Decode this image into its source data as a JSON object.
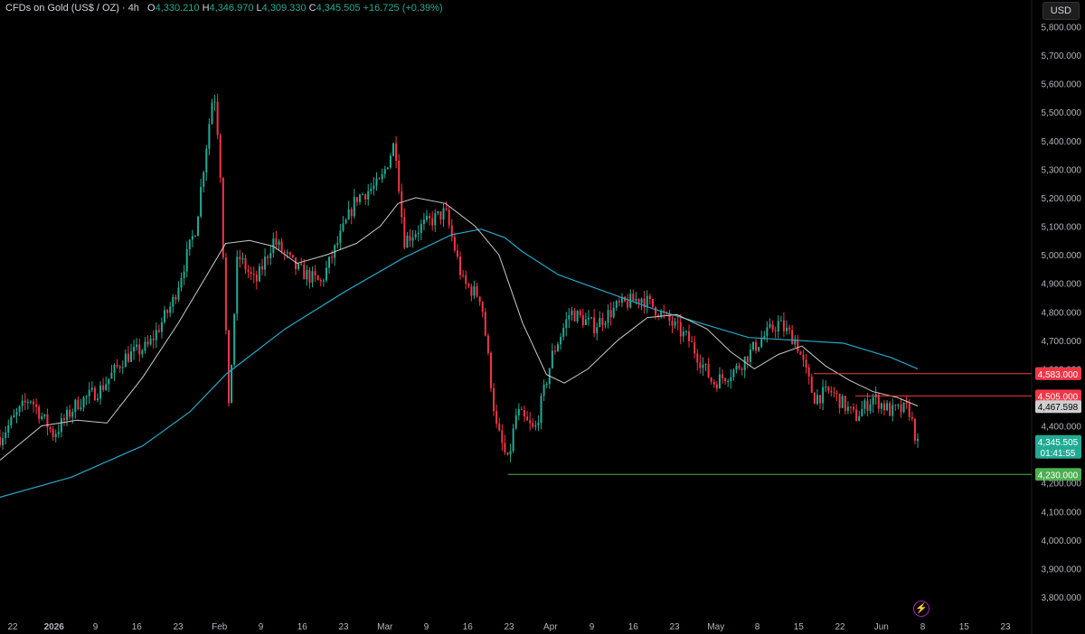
{
  "header": {
    "symbol": "CFDs on Gold (US$ / OZ) · 4h",
    "open_label": "O",
    "open": "4,330.210",
    "high_label": "H",
    "high": "4,346.970",
    "low_label": "L",
    "low": "4,309.330",
    "close_label": "C",
    "close": "4,345.505",
    "change": "+16.725 (+0.39%)"
  },
  "currency": "USD",
  "colors": {
    "up": "#22ab94",
    "down": "#f23645",
    "ma_fast": "#c9c9c9",
    "ma_slow": "#26a7c6",
    "support": "#4caf50",
    "background": "#000000",
    "axis_text": "#b2b5be"
  },
  "chart_data": {
    "type": "candlestick",
    "ylim": [
      3740,
      5830
    ],
    "y_ticks": [
      "3,800.000",
      "3,900.000",
      "4,000.000",
      "4,100.000",
      "4,200.000",
      "4,300.000",
      "4,400.000",
      "4,500.000",
      "4,600.000",
      "4,700.000",
      "4,800.000",
      "4,900.000",
      "5,000.000",
      "5,100.000",
      "5,200.000",
      "5,300.000",
      "5,400.000",
      "5,500.000",
      "5,600.000",
      "5,700.000",
      "5,800.000"
    ],
    "x_ticks": [
      "22",
      "2026",
      "9",
      "16",
      "23",
      "Feb",
      "9",
      "16",
      "23",
      "Mar",
      "9",
      "16",
      "23",
      "Apr",
      "9",
      "16",
      "23",
      "May",
      "8",
      "15",
      "22",
      "Jun",
      "8",
      "15",
      "23"
    ],
    "price_path": [
      {
        "x": 0,
        "y": 4360
      },
      {
        "x": 0.05,
        "y": 4500
      },
      {
        "x": 0.09,
        "y": 4370
      },
      {
        "x": 0.13,
        "y": 4480
      },
      {
        "x": 0.17,
        "y": 4530
      },
      {
        "x": 0.21,
        "y": 4640
      },
      {
        "x": 0.25,
        "y": 4680
      },
      {
        "x": 0.29,
        "y": 4830
      },
      {
        "x": 0.33,
        "y": 5100
      },
      {
        "x": 0.36,
        "y": 5590
      },
      {
        "x": 0.37,
        "y": 5350
      },
      {
        "x": 0.385,
        "y": 4450
      },
      {
        "x": 0.4,
        "y": 5000
      },
      {
        "x": 0.43,
        "y": 4900
      },
      {
        "x": 0.46,
        "y": 5050
      },
      {
        "x": 0.5,
        "y": 4950
      },
      {
        "x": 0.54,
        "y": 4900
      },
      {
        "x": 0.57,
        "y": 5050
      },
      {
        "x": 0.6,
        "y": 5200
      },
      {
        "x": 0.64,
        "y": 5250
      },
      {
        "x": 0.665,
        "y": 5400
      },
      {
        "x": 0.68,
        "y": 5050
      },
      {
        "x": 0.71,
        "y": 5100
      },
      {
        "x": 0.75,
        "y": 5150
      },
      {
        "x": 0.78,
        "y": 4900
      },
      {
        "x": 0.81,
        "y": 4850
      },
      {
        "x": 0.835,
        "y": 4400
      },
      {
        "x": 0.855,
        "y": 4270
      },
      {
        "x": 0.87,
        "y": 4450
      },
      {
        "x": 0.9,
        "y": 4380
      },
      {
        "x": 0.93,
        "y": 4650
      },
      {
        "x": 0.96,
        "y": 4800
      },
      {
        "x": 1.0,
        "y": 4750
      },
      {
        "x": 1.04,
        "y": 4820
      },
      {
        "x": 1.08,
        "y": 4850
      },
      {
        "x": 1.11,
        "y": 4800
      },
      {
        "x": 1.16,
        "y": 4700
      },
      {
        "x": 1.2,
        "y": 4550
      },
      {
        "x": 1.24,
        "y": 4600
      },
      {
        "x": 1.28,
        "y": 4700
      },
      {
        "x": 1.31,
        "y": 4760
      },
      {
        "x": 1.34,
        "y": 4700
      },
      {
        "x": 1.37,
        "y": 4500
      },
      {
        "x": 1.4,
        "y": 4520
      },
      {
        "x": 1.44,
        "y": 4430
      },
      {
        "x": 1.47,
        "y": 4500
      },
      {
        "x": 1.5,
        "y": 4450
      },
      {
        "x": 1.53,
        "y": 4460
      },
      {
        "x": 1.545,
        "y": 4330
      }
    ],
    "ma_fast": [
      {
        "x": 0,
        "y": 4280
      },
      {
        "x": 0.07,
        "y": 4400
      },
      {
        "x": 0.13,
        "y": 4420
      },
      {
        "x": 0.18,
        "y": 4410
      },
      {
        "x": 0.24,
        "y": 4570
      },
      {
        "x": 0.3,
        "y": 4760
      },
      {
        "x": 0.34,
        "y": 4900
      },
      {
        "x": 0.38,
        "y": 5040
      },
      {
        "x": 0.42,
        "y": 5050
      },
      {
        "x": 0.46,
        "y": 5030
      },
      {
        "x": 0.5,
        "y": 4970
      },
      {
        "x": 0.55,
        "y": 5000
      },
      {
        "x": 0.6,
        "y": 5040
      },
      {
        "x": 0.64,
        "y": 5100
      },
      {
        "x": 0.67,
        "y": 5180
      },
      {
        "x": 0.7,
        "y": 5200
      },
      {
        "x": 0.75,
        "y": 5180
      },
      {
        "x": 0.8,
        "y": 5100
      },
      {
        "x": 0.84,
        "y": 5000
      },
      {
        "x": 0.88,
        "y": 4760
      },
      {
        "x": 0.92,
        "y": 4580
      },
      {
        "x": 0.95,
        "y": 4550
      },
      {
        "x": 0.99,
        "y": 4600
      },
      {
        "x": 1.04,
        "y": 4700
      },
      {
        "x": 1.09,
        "y": 4780
      },
      {
        "x": 1.14,
        "y": 4790
      },
      {
        "x": 1.19,
        "y": 4740
      },
      {
        "x": 1.23,
        "y": 4660
      },
      {
        "x": 1.27,
        "y": 4600
      },
      {
        "x": 1.31,
        "y": 4650
      },
      {
        "x": 1.35,
        "y": 4680
      },
      {
        "x": 1.39,
        "y": 4610
      },
      {
        "x": 1.43,
        "y": 4560
      },
      {
        "x": 1.47,
        "y": 4520
      },
      {
        "x": 1.51,
        "y": 4500
      },
      {
        "x": 1.545,
        "y": 4470
      }
    ],
    "ma_slow": [
      {
        "x": 0,
        "y": 4150
      },
      {
        "x": 0.12,
        "y": 4220
      },
      {
        "x": 0.24,
        "y": 4330
      },
      {
        "x": 0.32,
        "y": 4450
      },
      {
        "x": 0.38,
        "y": 4580
      },
      {
        "x": 0.48,
        "y": 4740
      },
      {
        "x": 0.58,
        "y": 4870
      },
      {
        "x": 0.68,
        "y": 4990
      },
      {
        "x": 0.76,
        "y": 5070
      },
      {
        "x": 0.81,
        "y": 5090
      },
      {
        "x": 0.85,
        "y": 5060
      },
      {
        "x": 0.88,
        "y": 5010
      },
      {
        "x": 0.94,
        "y": 4930
      },
      {
        "x": 1.02,
        "y": 4870
      },
      {
        "x": 1.1,
        "y": 4810
      },
      {
        "x": 1.18,
        "y": 4760
      },
      {
        "x": 1.26,
        "y": 4710
      },
      {
        "x": 1.34,
        "y": 4700
      },
      {
        "x": 1.42,
        "y": 4690
      },
      {
        "x": 1.5,
        "y": 4640
      },
      {
        "x": 1.545,
        "y": 4600
      }
    ],
    "levels": [
      {
        "label": "4,583.490",
        "value": 4583.49,
        "color": "#26a7c6",
        "kind": "tag"
      },
      {
        "label": "4,583.000",
        "value": 4583.0,
        "color": "#f23645",
        "kind": "line",
        "from": 1.37
      },
      {
        "label": "4,505.000",
        "value": 4505.0,
        "color": "#f23645",
        "kind": "line",
        "from": 1.44
      },
      {
        "label": "4,467.598",
        "value": 4467.598,
        "color": "#cfcfcf",
        "kind": "tag"
      },
      {
        "label": "4,345.505",
        "value": 4345.505,
        "color": "#22ab94",
        "kind": "tag",
        "sub": "01:41:55"
      },
      {
        "label": "4,230.000",
        "value": 4230.0,
        "color": "#4caf50",
        "kind": "line",
        "from": 0.855
      }
    ]
  }
}
